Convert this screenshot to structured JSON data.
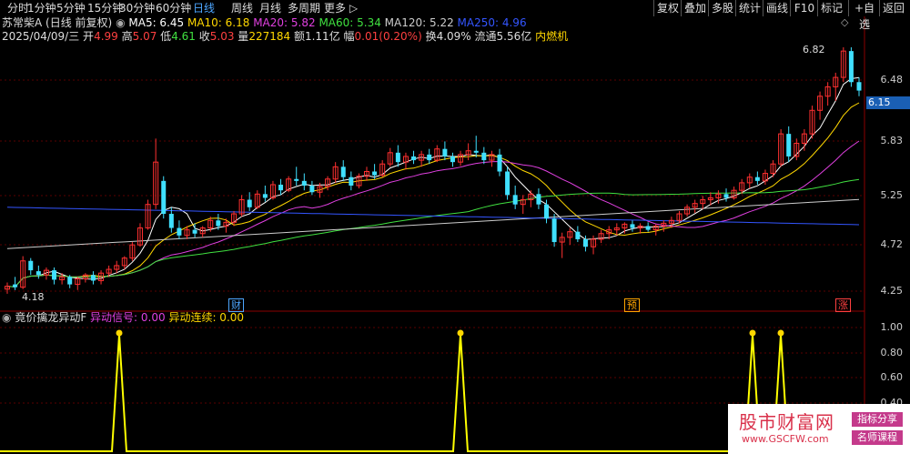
{
  "toolbar": {
    "periods": [
      "分时",
      "1分钟",
      "5分钟",
      "15分钟",
      "30分钟",
      "60分钟",
      "日线",
      "周线",
      "月线",
      "多周期",
      "更多"
    ],
    "active_period": "日线",
    "buttons": [
      "复权",
      "叠加",
      "多股",
      "统计",
      "画线",
      "F10",
      "标记",
      "+自选",
      "返回"
    ]
  },
  "stock": {
    "name": "苏常柴A",
    "mode": "(日线 前复权)",
    "ma": [
      {
        "label": "MA5: 6.45",
        "color": "#ffffff"
      },
      {
        "label": "MA10: 6.18",
        "color": "#ffd700"
      },
      {
        "label": "MA20: 5.82",
        "color": "#e040e0"
      },
      {
        "label": "MA60: 5.34",
        "color": "#40e040"
      },
      {
        "label": "MA120: 5.22",
        "color": "#cccccc"
      },
      {
        "label": "MA250: 4.96",
        "color": "#3355ff"
      }
    ],
    "date": "2025/04/09/三",
    "open_label": "开",
    "open": "4.99",
    "high_label": "高",
    "high": "5.07",
    "low_label": "低",
    "low": "4.61",
    "close_label": "收",
    "close": "5.03",
    "vol_label": "量",
    "vol": "227184",
    "amt_label": "额",
    "amt": "1.11亿",
    "chg_label": "幅",
    "chg": "0.01(0.20%)",
    "turnover": "换4.09%",
    "float": "流通5.56亿",
    "sector": "内燃机"
  },
  "price_axis": [
    "6.48",
    "5.83",
    "5.25",
    "4.72",
    "4.25"
  ],
  "current_price": "6.15",
  "marks": {
    "high": "6.82",
    "low": "4.18",
    "cai": "财",
    "yu": "预",
    "zhang": "涨"
  },
  "indicator": {
    "name": "竟价擒龙异动F",
    "s1_label": "异动信号: 0.00",
    "s2_label": "异动连续: 0.00",
    "axis": [
      "1.00",
      "0.80",
      "0.60",
      "0.40"
    ]
  },
  "chart_data": {
    "type": "candlestick",
    "ylim": [
      4.18,
      6.82
    ],
    "candles": [
      [
        4.25,
        4.32,
        4.2,
        4.28
      ],
      [
        4.3,
        4.38,
        4.24,
        4.27
      ],
      [
        4.27,
        4.6,
        4.25,
        4.55
      ],
      [
        4.55,
        4.58,
        4.4,
        4.45
      ],
      [
        4.44,
        4.5,
        4.36,
        4.4
      ],
      [
        4.4,
        4.48,
        4.35,
        4.45
      ],
      [
        4.45,
        4.48,
        4.3,
        4.35
      ],
      [
        4.35,
        4.42,
        4.3,
        4.38
      ],
      [
        4.38,
        4.4,
        4.26,
        4.3
      ],
      [
        4.3,
        4.38,
        4.24,
        4.36
      ],
      [
        4.36,
        4.42,
        4.32,
        4.4
      ],
      [
        4.4,
        4.44,
        4.3,
        4.34
      ],
      [
        4.34,
        4.45,
        4.3,
        4.42
      ],
      [
        4.42,
        4.5,
        4.38,
        4.46
      ],
      [
        4.46,
        4.55,
        4.42,
        4.5
      ],
      [
        4.5,
        4.6,
        4.46,
        4.58
      ],
      [
        4.58,
        4.75,
        4.55,
        4.72
      ],
      [
        4.72,
        4.95,
        4.7,
        4.9
      ],
      [
        4.9,
        5.2,
        4.88,
        5.15
      ],
      [
        5.15,
        5.85,
        5.1,
        5.6
      ],
      [
        5.4,
        5.45,
        5.0,
        5.05
      ],
      [
        5.05,
        5.12,
        4.85,
        4.9
      ],
      [
        4.9,
        4.98,
        4.78,
        4.82
      ],
      [
        4.82,
        4.92,
        4.78,
        4.88
      ],
      [
        4.88,
        4.95,
        4.8,
        4.84
      ],
      [
        4.84,
        4.92,
        4.8,
        4.9
      ],
      [
        4.9,
        5.02,
        4.86,
        4.98
      ],
      [
        4.98,
        5.05,
        4.88,
        4.92
      ],
      [
        4.92,
        5.0,
        4.85,
        4.96
      ],
      [
        4.96,
        5.08,
        4.92,
        5.05
      ],
      [
        5.05,
        5.25,
        5.02,
        5.2
      ],
      [
        5.2,
        5.28,
        5.08,
        5.12
      ],
      [
        5.12,
        5.3,
        5.1,
        5.26
      ],
      [
        5.26,
        5.35,
        5.18,
        5.22
      ],
      [
        5.22,
        5.4,
        5.2,
        5.36
      ],
      [
        5.36,
        5.42,
        5.25,
        5.3
      ],
      [
        5.3,
        5.45,
        5.28,
        5.42
      ],
      [
        5.42,
        5.55,
        5.35,
        5.4
      ],
      [
        5.4,
        5.48,
        5.3,
        5.35
      ],
      [
        5.35,
        5.4,
        5.25,
        5.28
      ],
      [
        5.28,
        5.38,
        5.22,
        5.34
      ],
      [
        5.34,
        5.45,
        5.3,
        5.42
      ],
      [
        5.42,
        5.6,
        5.38,
        5.55
      ],
      [
        5.55,
        5.62,
        5.4,
        5.44
      ],
      [
        5.44,
        5.5,
        5.3,
        5.35
      ],
      [
        5.35,
        5.48,
        5.32,
        5.45
      ],
      [
        5.45,
        5.55,
        5.4,
        5.5
      ],
      [
        5.5,
        5.58,
        5.42,
        5.46
      ],
      [
        5.46,
        5.62,
        5.44,
        5.58
      ],
      [
        5.58,
        5.75,
        5.55,
        5.7
      ],
      [
        5.7,
        5.78,
        5.55,
        5.6
      ],
      [
        5.6,
        5.7,
        5.52,
        5.66
      ],
      [
        5.66,
        5.72,
        5.58,
        5.62
      ],
      [
        5.62,
        5.72,
        5.55,
        5.68
      ],
      [
        5.68,
        5.74,
        5.58,
        5.62
      ],
      [
        5.62,
        5.78,
        5.6,
        5.74
      ],
      [
        5.74,
        5.82,
        5.62,
        5.66
      ],
      [
        5.66,
        5.7,
        5.55,
        5.6
      ],
      [
        5.6,
        5.72,
        5.56,
        5.68
      ],
      [
        5.68,
        5.8,
        5.62,
        5.72
      ],
      [
        5.72,
        5.88,
        5.65,
        5.7
      ],
      [
        5.7,
        5.76,
        5.58,
        5.62
      ],
      [
        5.62,
        5.72,
        5.55,
        5.68
      ],
      [
        5.68,
        5.74,
        5.45,
        5.5
      ],
      [
        5.5,
        5.55,
        5.2,
        5.25
      ],
      [
        5.25,
        5.35,
        5.1,
        5.15
      ],
      [
        5.15,
        5.25,
        5.05,
        5.2
      ],
      [
        5.2,
        5.3,
        5.12,
        5.26
      ],
      [
        5.26,
        5.32,
        5.1,
        5.15
      ],
      [
        5.15,
        5.2,
        4.95,
        5.0
      ],
      [
        5.0,
        5.05,
        4.7,
        4.75
      ],
      [
        4.75,
        4.85,
        4.58,
        4.8
      ],
      [
        4.8,
        4.9,
        4.72,
        4.86
      ],
      [
        4.86,
        4.92,
        4.75,
        4.78
      ],
      [
        4.78,
        4.82,
        4.65,
        4.7
      ],
      [
        4.7,
        4.82,
        4.62,
        4.78
      ],
      [
        4.78,
        4.88,
        4.74,
        4.84
      ],
      [
        4.84,
        4.92,
        4.78,
        4.88
      ],
      [
        4.88,
        4.95,
        4.82,
        4.9
      ],
      [
        4.9,
        4.96,
        4.84,
        4.94
      ],
      [
        4.94,
        4.98,
        4.86,
        4.9
      ],
      [
        4.9,
        4.95,
        4.84,
        4.92
      ],
      [
        4.92,
        4.96,
        4.86,
        4.88
      ],
      [
        4.88,
        4.94,
        4.82,
        4.92
      ],
      [
        4.92,
        4.98,
        4.86,
        4.95
      ],
      [
        4.95,
        5.02,
        4.9,
        4.98
      ],
      [
        4.98,
        5.08,
        4.95,
        5.05
      ],
      [
        5.05,
        5.15,
        5.02,
        5.12
      ],
      [
        5.12,
        5.2,
        5.06,
        5.16
      ],
      [
        5.16,
        5.24,
        5.1,
        5.2
      ],
      [
        5.2,
        5.28,
        5.14,
        5.22
      ],
      [
        5.22,
        5.3,
        5.16,
        5.26
      ],
      [
        5.26,
        5.32,
        5.18,
        5.22
      ],
      [
        5.22,
        5.34,
        5.2,
        5.3
      ],
      [
        5.3,
        5.42,
        5.26,
        5.38
      ],
      [
        5.38,
        5.48,
        5.32,
        5.44
      ],
      [
        5.44,
        5.5,
        5.36,
        5.4
      ],
      [
        5.4,
        5.52,
        5.36,
        5.48
      ],
      [
        5.48,
        5.62,
        5.44,
        5.58
      ],
      [
        5.58,
        5.95,
        5.55,
        5.9
      ],
      [
        5.9,
        5.98,
        5.6,
        5.66
      ],
      [
        5.66,
        5.85,
        5.62,
        5.8
      ],
      [
        5.8,
        5.95,
        5.72,
        5.9
      ],
      [
        5.9,
        6.2,
        5.85,
        6.15
      ],
      [
        6.15,
        6.35,
        6.05,
        6.3
      ],
      [
        6.3,
        6.45,
        6.2,
        6.4
      ],
      [
        6.4,
        6.55,
        6.25,
        6.5
      ],
      [
        6.5,
        6.82,
        6.45,
        6.78
      ],
      [
        6.78,
        6.82,
        6.4,
        6.45
      ],
      [
        6.45,
        6.5,
        6.3,
        6.36
      ]
    ],
    "signal_spikes": [
      0.0,
      1.0
    ],
    "signal_ylim": [
      0.4,
      1.0
    ]
  }
}
